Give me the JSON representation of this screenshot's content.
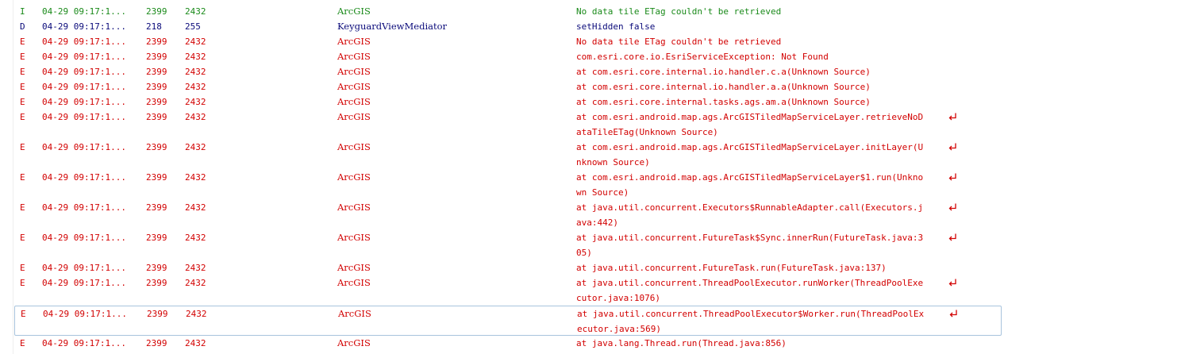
{
  "log": {
    "colors": {
      "I": "#1a8a1a",
      "D": "#0a0a7a",
      "E": "#d20000"
    },
    "rows": [
      {
        "level": "I",
        "time": "04-29 09:17:1...",
        "pid": "2399",
        "tid": "2432",
        "tag": "ArcGIS",
        "text": [
          "No data tile ETag couldn't be retrieved"
        ]
      },
      {
        "level": "D",
        "time": "04-29 09:17:1...",
        "pid": "218",
        "tid": "255",
        "tag": "KeyguardViewMediator",
        "text": [
          "setHidden false"
        ]
      },
      {
        "level": "E",
        "time": "04-29 09:17:1...",
        "pid": "2399",
        "tid": "2432",
        "tag": "ArcGIS",
        "text": [
          "No data tile ETag couldn't be retrieved"
        ]
      },
      {
        "level": "E",
        "time": "04-29 09:17:1...",
        "pid": "2399",
        "tid": "2432",
        "tag": "ArcGIS",
        "text": [
          "com.esri.core.io.EsriServiceException: Not Found"
        ]
      },
      {
        "level": "E",
        "time": "04-29 09:17:1...",
        "pid": "2399",
        "tid": "2432",
        "tag": "ArcGIS",
        "text": [
          "at com.esri.core.internal.io.handler.c.a(Unknown Source)"
        ]
      },
      {
        "level": "E",
        "time": "04-29 09:17:1...",
        "pid": "2399",
        "tid": "2432",
        "tag": "ArcGIS",
        "text": [
          "at com.esri.core.internal.io.handler.a.a(Unknown Source)"
        ]
      },
      {
        "level": "E",
        "time": "04-29 09:17:1...",
        "pid": "2399",
        "tid": "2432",
        "tag": "ArcGIS",
        "text": [
          "at com.esri.core.internal.tasks.ags.am.a(Unknown Source)"
        ]
      },
      {
        "level": "E",
        "time": "04-29 09:17:1...",
        "pid": "2399",
        "tid": "2432",
        "tag": "ArcGIS",
        "text": [
          "at com.esri.android.map.ags.ArcGISTiledMapServiceLayer.retrieveNoD",
          "ataTileETag(Unknown Source)"
        ]
      },
      {
        "level": "E",
        "time": "04-29 09:17:1...",
        "pid": "2399",
        "tid": "2432",
        "tag": "ArcGIS",
        "text": [
          "at com.esri.android.map.ags.ArcGISTiledMapServiceLayer.initLayer(U",
          "nknown Source)"
        ]
      },
      {
        "level": "E",
        "time": "04-29 09:17:1...",
        "pid": "2399",
        "tid": "2432",
        "tag": "ArcGIS",
        "text": [
          "at com.esri.android.map.ags.ArcGISTiledMapServiceLayer$1.run(Unkno",
          "wn Source)"
        ]
      },
      {
        "level": "E",
        "time": "04-29 09:17:1...",
        "pid": "2399",
        "tid": "2432",
        "tag": "ArcGIS",
        "text": [
          "at java.util.concurrent.Executors$RunnableAdapter.call(Executors.j",
          "ava:442)"
        ]
      },
      {
        "level": "E",
        "time": "04-29 09:17:1...",
        "pid": "2399",
        "tid": "2432",
        "tag": "ArcGIS",
        "text": [
          "at java.util.concurrent.FutureTask$Sync.innerRun(FutureTask.java:3",
          "05)"
        ]
      },
      {
        "level": "E",
        "time": "04-29 09:17:1...",
        "pid": "2399",
        "tid": "2432",
        "tag": "ArcGIS",
        "text": [
          "at java.util.concurrent.FutureTask.run(FutureTask.java:137)"
        ]
      },
      {
        "level": "E",
        "time": "04-29 09:17:1...",
        "pid": "2399",
        "tid": "2432",
        "tag": "ArcGIS",
        "text": [
          "at java.util.concurrent.ThreadPoolExecutor.runWorker(ThreadPoolExe",
          "cutor.java:1076)"
        ]
      },
      {
        "level": "E",
        "time": "04-29 09:17:1...",
        "pid": "2399",
        "tid": "2432",
        "tag": "ArcGIS",
        "text": [
          "at java.util.concurrent.ThreadPoolExecutor$Worker.run(ThreadPoolEx",
          "ecutor.java:569)"
        ],
        "selected": true
      },
      {
        "level": "E",
        "time": "04-29 09:17:1...",
        "pid": "2399",
        "tid": "2432",
        "tag": "ArcGIS",
        "text": [
          "at java.lang.Thread.run(Thread.java:856)"
        ]
      }
    ],
    "wrap_icon": "wrap-arrow-icon"
  }
}
